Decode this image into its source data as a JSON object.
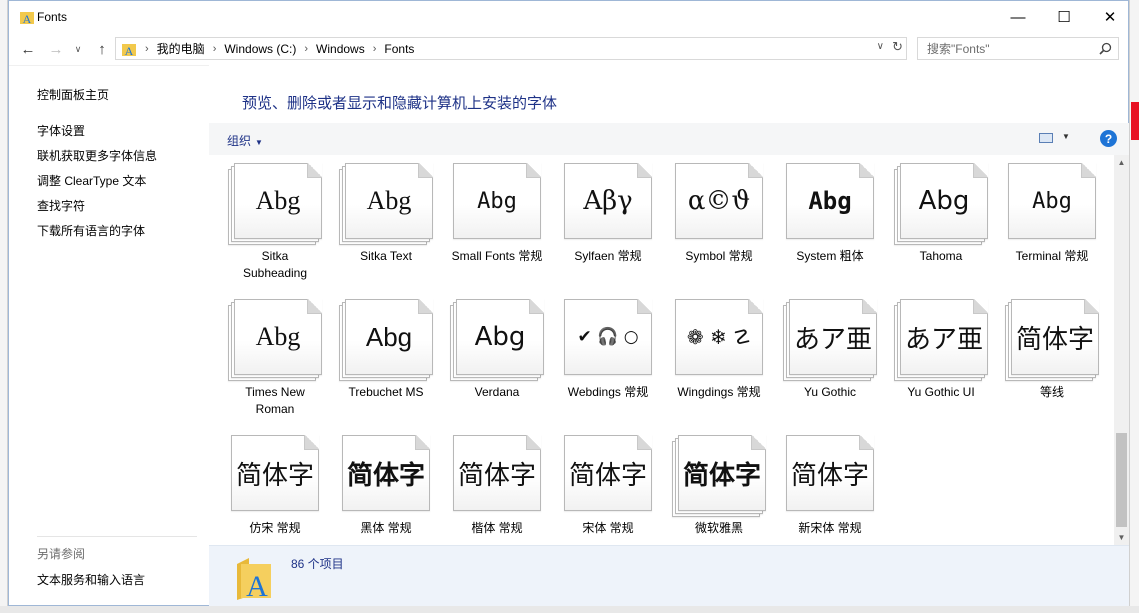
{
  "window": {
    "title": "Fonts",
    "minimize": "—",
    "maximize": "☐",
    "close": "✕"
  },
  "nav": {
    "back": "←",
    "forward": "→",
    "recent": "∨",
    "up": "↑",
    "breadcrumbs": [
      "我的电脑",
      "Windows (C:)",
      "Windows",
      "Fonts"
    ],
    "separator": "›",
    "search_placeholder": "搜索\"Fonts\""
  },
  "sidebar": {
    "links": [
      "控制面板主页",
      "字体设置",
      "联机获取更多字体信息",
      "调整 ClearType 文本",
      "查找字符",
      "下载所有语言的字体"
    ],
    "see_also_title": "另请参阅",
    "see_also_links": [
      "文本服务和输入语言"
    ]
  },
  "main": {
    "heading": "预览、删除或者显示和隐藏计算机上安装的字体",
    "organize_label": "组织",
    "help_label": "?"
  },
  "fonts": [
    {
      "name": "Sitka Subheading",
      "sample": "Abg",
      "stacked": true
    },
    {
      "name": "Sitka Text",
      "sample": "Abg",
      "stacked": true
    },
    {
      "name": "Small Fonts 常规",
      "sample": "Abg",
      "stacked": false
    },
    {
      "name": "Sylfaen 常规",
      "sample": "Αβγ",
      "stacked": false
    },
    {
      "name": "Symbol 常规",
      "sample": "α©ϑ",
      "stacked": false
    },
    {
      "name": "System 粗体",
      "sample": "Abg",
      "stacked": false
    },
    {
      "name": "Tahoma",
      "sample": "Abg",
      "stacked": true
    },
    {
      "name": "Terminal 常规",
      "sample": "Abg",
      "stacked": false
    },
    {
      "name": "Times New Roman",
      "sample": "Abg",
      "stacked": true
    },
    {
      "name": "Trebuchet MS",
      "sample": "Abg",
      "stacked": true
    },
    {
      "name": "Verdana",
      "sample": "Abg",
      "stacked": true
    },
    {
      "name": "Webdings 常规",
      "sample": "✔ 🎧 ○",
      "stacked": false
    },
    {
      "name": "Wingdings 常规",
      "sample": "❁ ❄ ☡",
      "stacked": false
    },
    {
      "name": "Yu Gothic",
      "sample": "あア亜",
      "stacked": true
    },
    {
      "name": "Yu Gothic UI",
      "sample": "あア亜",
      "stacked": true
    },
    {
      "name": "等线",
      "sample": "简体字",
      "stacked": true
    },
    {
      "name": "仿宋 常规",
      "sample": "简体字",
      "stacked": false
    },
    {
      "name": "黑体 常规",
      "sample": "简体字",
      "stacked": false
    },
    {
      "name": "楷体 常规",
      "sample": "简体字",
      "stacked": false
    },
    {
      "name": "宋体 常规",
      "sample": "简体字",
      "stacked": false
    },
    {
      "name": "微软雅黑",
      "sample": "简体字",
      "stacked": true
    },
    {
      "name": "新宋体 常规",
      "sample": "简体字",
      "stacked": false
    }
  ],
  "details": {
    "item_count": "86 个项目"
  },
  "colors": {
    "link_blue": "#1e3287",
    "toolbar_bg": "#f5f6f7",
    "details_bg": "#eef3fa",
    "help_blue": "#1e74d6"
  }
}
